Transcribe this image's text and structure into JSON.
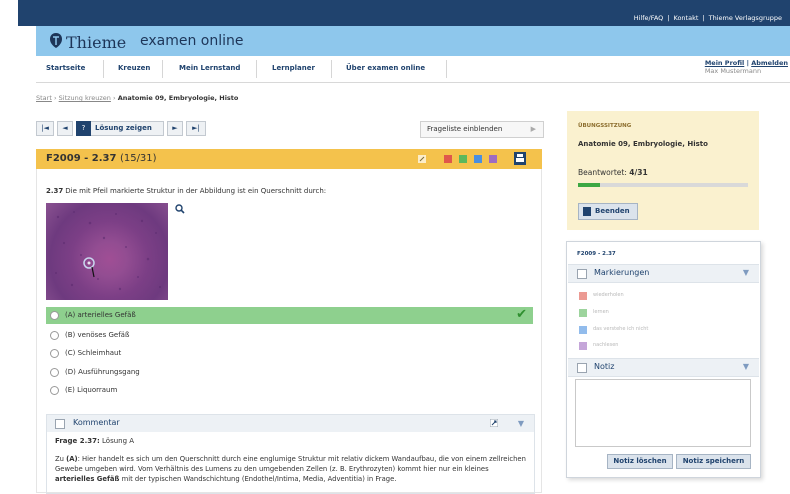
{
  "top_links": [
    "Hilfe/FAQ",
    "Kontakt",
    "Thieme Verlagsgruppe"
  ],
  "top_separator": "|",
  "brand": {
    "name": "Thieme",
    "product": "examen online"
  },
  "nav": {
    "items": [
      "Startseite",
      "Kreuzen",
      "Mein Lernstand",
      "Lernplaner",
      "Über examen online"
    ],
    "profile_link": "Mein Profil",
    "separator": "|",
    "logout_link": "Abmelden",
    "user": "Max Mustermann"
  },
  "breadcrumb": {
    "items": [
      "Start",
      "Sitzung kreuzen"
    ],
    "separator": "›",
    "current": "Anatomie 09, Embryologie, Histo"
  },
  "toolbar": {
    "first": "|◄",
    "prev": "◄",
    "solution_icon": "?",
    "solution_label": "Lösung zeigen",
    "next": "►",
    "last": "►|",
    "fragelist_label": "Frageliste einblenden",
    "fragelist_arrow": "▶"
  },
  "question": {
    "id": "F2009 - 2.37",
    "count": "(15/31)",
    "number": "2.37",
    "text": "Die mit Pfeil markierte Struktur in der Abbildung ist ein Querschnitt durch:",
    "answers": [
      {
        "label": "(A) arterielles Gefäß",
        "correct": true
      },
      {
        "label": "(B) venöses Gefäß",
        "correct": false
      },
      {
        "label": "(C) Schleimhaut",
        "correct": false
      },
      {
        "label": "(D) Ausführungsgang",
        "correct": false
      },
      {
        "label": "(E) Liquorraum",
        "correct": false
      }
    ],
    "check_icon": "✔"
  },
  "marker_colors": [
    "#e0574b",
    "#5cb85c",
    "#4a8fe0",
    "#9e6bc0"
  ],
  "comment": {
    "title": "Kommentar",
    "frage_label": "Frage 2.37:",
    "frage_value": "Lösung A",
    "body_prefix": "Zu ",
    "body_letter": "(A)",
    "body_1": ": Hier handelt es sich um den Querschnitt durch eine englumige Struktur mit relativ dickem Wandaufbau, die von einem zellreichen Gewebe umgeben wird. Vom Verhältnis des Lumens zu den umgebenden Zellen (z. B. Erythrozyten) kommt hier nur ein kleines ",
    "body_bold": "arterielles Gefäß",
    "body_2": " mit der typischen Wandschichtung (Endothel/Intima, Media, Adventitia) in Frage.",
    "collapse_icon": "▼"
  },
  "session": {
    "label": "ÜBUNGSSITZUNG",
    "name": "Anatomie 09, Embryologie, Histo",
    "answered_label": "Beantwortet:",
    "answered_value": "4/31",
    "progress_fraction": 0.13,
    "end_button": "Beenden"
  },
  "sidebar": {
    "question_id": "F2009 - 2.37",
    "markierungen_title": "Markierungen",
    "markers": [
      {
        "label": "wiederholen",
        "color": "#e0574b"
      },
      {
        "label": "lernen",
        "color": "#5cb85c"
      },
      {
        "label": "das verstehe ich nicht",
        "color": "#4a8fe0"
      },
      {
        "label": "nachlesen",
        "color": "#9e6bc0"
      }
    ],
    "notiz_title": "Notiz",
    "notiz_text": "",
    "delete_button": "Notiz löschen",
    "save_button": "Notiz speichern",
    "collapse_icon": "▼"
  }
}
